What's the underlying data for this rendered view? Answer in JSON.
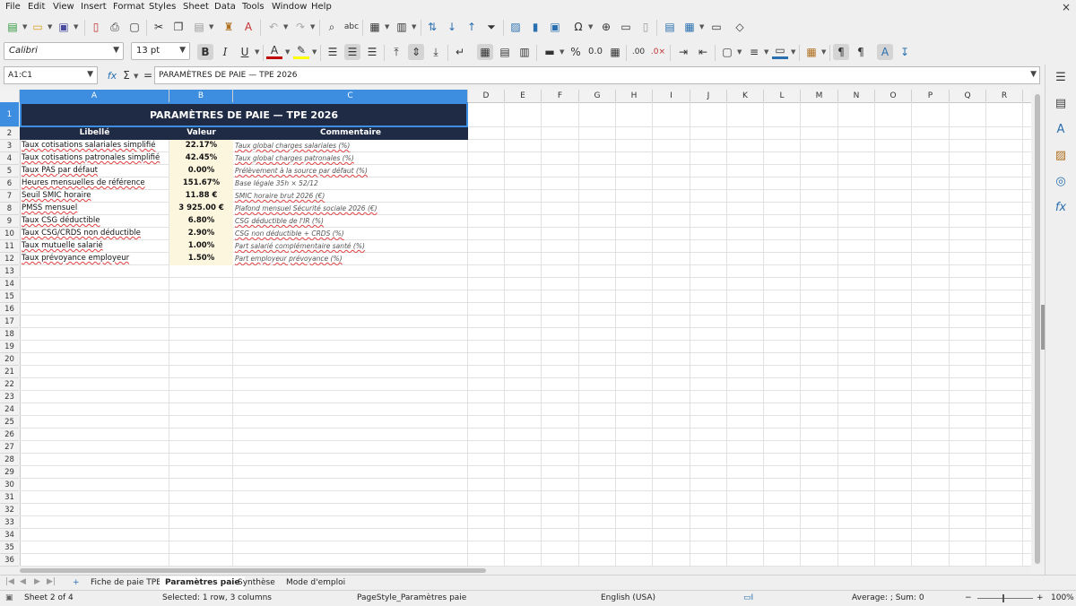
{
  "menubar": {
    "items": [
      "File",
      "Edit",
      "View",
      "Insert",
      "Format",
      "Styles",
      "Sheet",
      "Data",
      "Tools",
      "Window",
      "Help"
    ],
    "close_glyph": "×"
  },
  "toolbar": {
    "font_name": "Calibri",
    "font_size": "13 pt",
    "font_color": "#c00000",
    "highlight_color": "#ffff00",
    "border_color": "#2a6fb0"
  },
  "formula_bar": {
    "name_box": "A1:C1",
    "fx": "fx",
    "sigma": "Σ",
    "equals": "=",
    "content": "PARAMÈTRES DE PAIE — TPE 2026"
  },
  "columns": [
    "A",
    "B",
    "C",
    "D",
    "E",
    "F",
    "G",
    "H",
    "I",
    "J",
    "K",
    "L",
    "M",
    "N",
    "O",
    "P",
    "Q",
    "R"
  ],
  "rows": [
    "1",
    "2",
    "3",
    "4",
    "5",
    "6",
    "7",
    "8",
    "9",
    "10",
    "11",
    "12",
    "13",
    "14",
    "15",
    "16",
    "17",
    "18",
    "19",
    "20",
    "21",
    "22",
    "23",
    "24",
    "25",
    "26",
    "27",
    "28",
    "29",
    "30",
    "31",
    "32",
    "33",
    "34",
    "35",
    "36"
  ],
  "sheet": {
    "title": "PARAMÈTRES DE PAIE — TPE 2026",
    "headers": [
      "Libellé",
      "Valeur",
      "Commentaire"
    ],
    "rows": [
      {
        "label": "Taux cotisations salariales simplifié",
        "value": "22.17%",
        "comment": "Taux global charges salariales (%)"
      },
      {
        "label": "Taux cotisations patronales simplifié",
        "value": "42.45%",
        "comment": "Taux global charges patronales (%)"
      },
      {
        "label": "Taux PAS par défaut",
        "value": "0.00%",
        "comment": "Prélèvement à la source par défaut (%)"
      },
      {
        "label": "Heures mensuelles de référence",
        "value": "151.67%",
        "comment": "Base légale 35h × 52/12"
      },
      {
        "label": "Seuil SMIC horaire",
        "value": "11.88 €",
        "comment": "SMIC horaire brut 2026 (€)"
      },
      {
        "label": "PMSS mensuel",
        "value": "3 925.00 €",
        "comment": "Plafond mensuel Sécurité sociale 2026 (€)"
      },
      {
        "label": "Taux CSG déductible",
        "value": "6.80%",
        "comment": "CSG déductible de l'IR (%)"
      },
      {
        "label": "Taux CSG/CRDS non déductible",
        "value": "2.90%",
        "comment": "CSG non déductible + CRDS (%)"
      },
      {
        "label": "Taux mutuelle salarié",
        "value": "1.00%",
        "comment": "Part salarié complémentaire santé (%)"
      },
      {
        "label": "Taux prévoyance employeur",
        "value": "1.50%",
        "comment": "Part employeur prévoyance (%)"
      }
    ]
  },
  "tabs": {
    "add": "+",
    "items": [
      "Fiche de paie TPE",
      "Paramètres paie",
      "Synthèse",
      "Mode d'emploi"
    ],
    "active_index": 1
  },
  "status": {
    "sheet": "Sheet 2 of 4",
    "selection": "Selected: 1 row, 3 columns",
    "page_style": "PageStyle_Paramètres paie",
    "language": "English (USA)",
    "sum": "Average: ; Sum: 0",
    "zoom_minus": "−",
    "zoom_plus": "+",
    "zoom": "100%"
  }
}
